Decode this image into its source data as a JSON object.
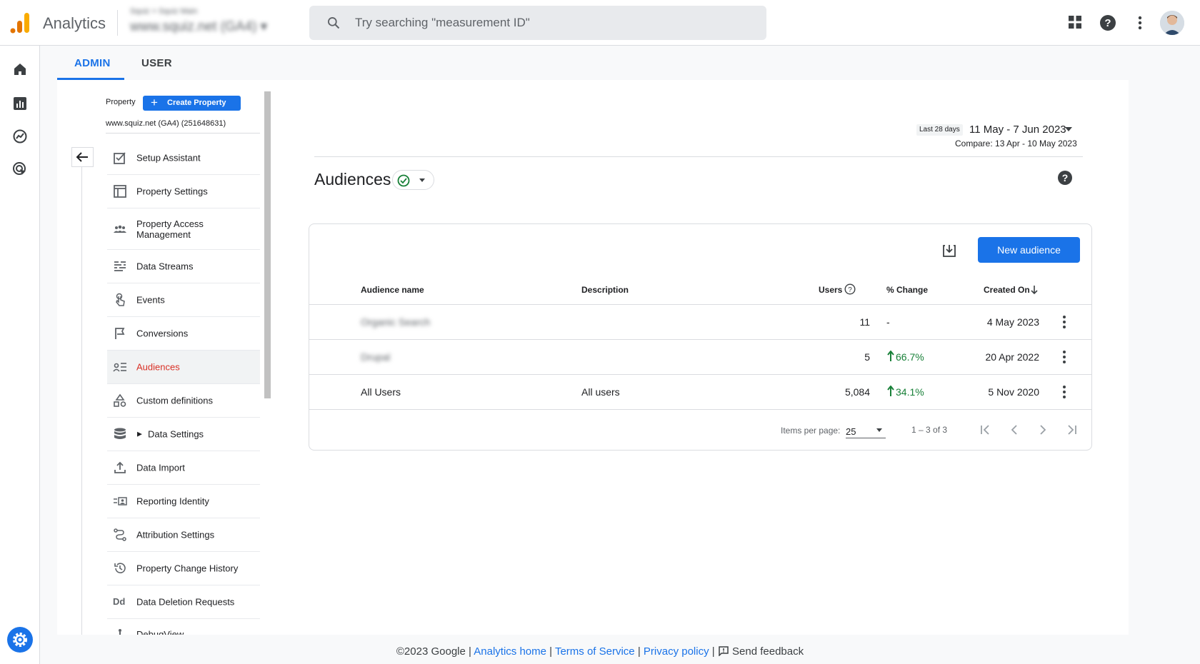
{
  "app": {
    "title": "Analytics"
  },
  "account": {
    "line1": "Squiz > Squiz Main",
    "line2": "www.squiz.net (GA4)"
  },
  "search": {
    "placeholder": "Try searching \"measurement ID\""
  },
  "tabs": [
    {
      "label": "ADMIN"
    },
    {
      "label": "USER"
    }
  ],
  "property": {
    "label": "Property",
    "create_label": "Create Property",
    "name": "www.squiz.net (GA4) (251648631)"
  },
  "nav": {
    "items": [
      {
        "label": "Setup Assistant",
        "icon": "checkbox-icon"
      },
      {
        "label": "Property Settings",
        "icon": "layout-icon"
      },
      {
        "label": "Property Access Management",
        "icon": "people-icon"
      },
      {
        "label": "Data Streams",
        "icon": "streams-icon"
      },
      {
        "label": "Events",
        "icon": "touch-icon"
      },
      {
        "label": "Conversions",
        "icon": "flag-icon"
      },
      {
        "label": "Audiences",
        "icon": "audience-icon"
      },
      {
        "label": "Custom definitions",
        "icon": "shapes-icon"
      },
      {
        "label": "Data Settings",
        "icon": "database-icon"
      },
      {
        "label": "Data Import",
        "icon": "upload-icon"
      },
      {
        "label": "Reporting Identity",
        "icon": "identity-icon"
      },
      {
        "label": "Attribution Settings",
        "icon": "attribution-icon"
      },
      {
        "label": "Property Change History",
        "icon": "history-icon"
      },
      {
        "label": "Data Deletion Requests",
        "icon": "dd-icon"
      },
      {
        "label": "DebugView",
        "icon": "debug-icon"
      }
    ]
  },
  "date": {
    "chip": "Last 28 days",
    "range": "11 May - 7 Jun 2023",
    "compare": "Compare: 13 Apr - 10 May 2023"
  },
  "page": {
    "title": "Audiences"
  },
  "card": {
    "new_audience_label": "New audience",
    "columns": {
      "name": "Audience name",
      "description": "Description",
      "users": "Users",
      "change": "% Change",
      "created": "Created On"
    },
    "rows": [
      {
        "name": "Organic Search",
        "description": "",
        "users": "11",
        "change": "-",
        "created": "4 May 2023"
      },
      {
        "name": "Drupal",
        "description": "",
        "users": "5",
        "change": "66.7%",
        "created": "20 Apr 2022"
      },
      {
        "name": "All Users",
        "description": "All users",
        "users": "5,084",
        "change": "34.1%",
        "created": "5 Nov 2020"
      }
    ],
    "pagination": {
      "items_per_page_label": "Items per page:",
      "items_per_page_value": "25",
      "range": "1 – 3 of 3"
    }
  },
  "footer": {
    "copyright": "©2023 Google",
    "analytics_home": "Analytics home",
    "terms": "Terms of Service",
    "privacy": "Privacy policy",
    "feedback": "Send feedback"
  },
  "colors": {
    "accent": "#1a73e8",
    "active_nav": "#d93025",
    "positive": "#188038"
  }
}
